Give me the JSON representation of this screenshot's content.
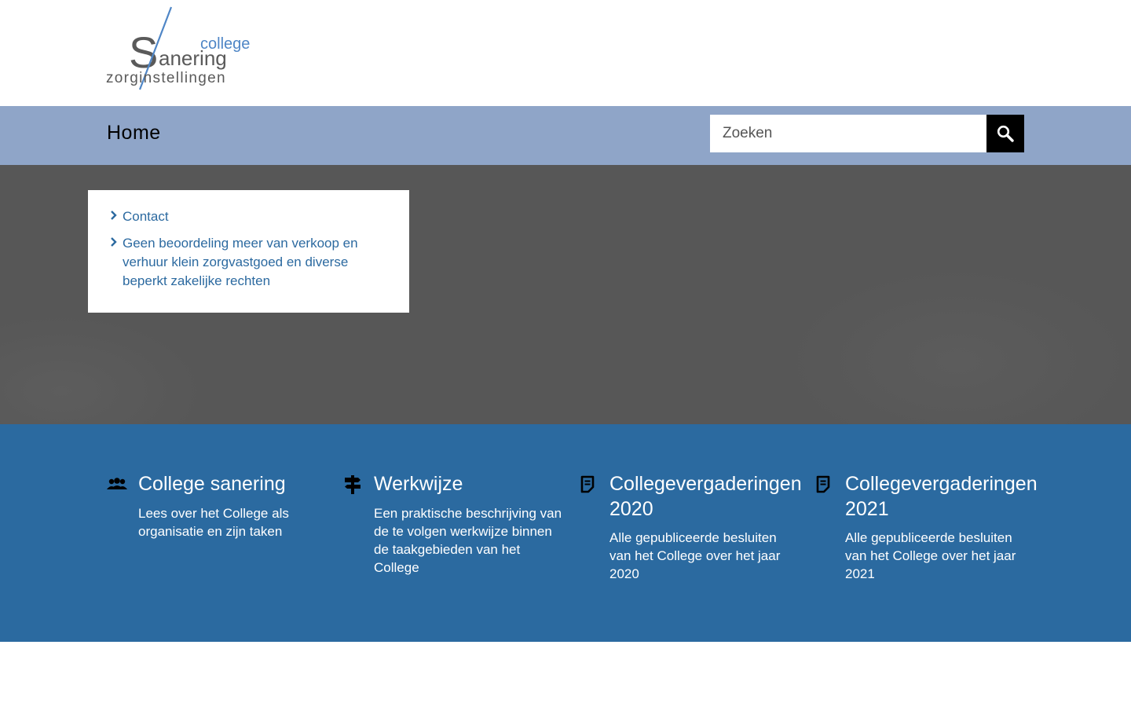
{
  "header": {
    "logo": {
      "line_college": "college",
      "line_sanering": "anering",
      "line_s": "S",
      "line_zorg": "zorginstellingen"
    }
  },
  "nav": {
    "home_label": "Home",
    "search": {
      "placeholder": "Zoeken",
      "value": "",
      "button_icon": "search-icon"
    }
  },
  "hero": {
    "news_items": [
      {
        "label": "Contact"
      },
      {
        "label": "Geen beoordeling meer van verkoop en verhuur klein zorgvastgoed en diverse beperkt zakelijke rechten"
      }
    ]
  },
  "features": [
    {
      "icon": "users-icon",
      "title": "College sanering",
      "description": "Lees over het College als organisatie en zijn taken"
    },
    {
      "icon": "signpost-icon",
      "title": "Werkwijze",
      "description": "Een praktische beschrijving van de te volgen werkwijze binnen de taakgebieden van het College"
    },
    {
      "icon": "document-icon",
      "title": "Collegevergaderingen 2020",
      "description": "Alle gepubliceerde besluiten van het College over het jaar 2020"
    },
    {
      "icon": "document-icon",
      "title": "Collegevergaderingen 2021",
      "description": "Alle gepubliceerde besluiten van het College over het jaar 2021"
    }
  ],
  "colors": {
    "nav_bg": "#8fa5c8",
    "hero_bg": "#575757",
    "features_bg": "#2b6aa0",
    "link": "#2c6aa0",
    "logo_blue": "#4f86c6",
    "logo_gray": "#5a5a5a"
  }
}
